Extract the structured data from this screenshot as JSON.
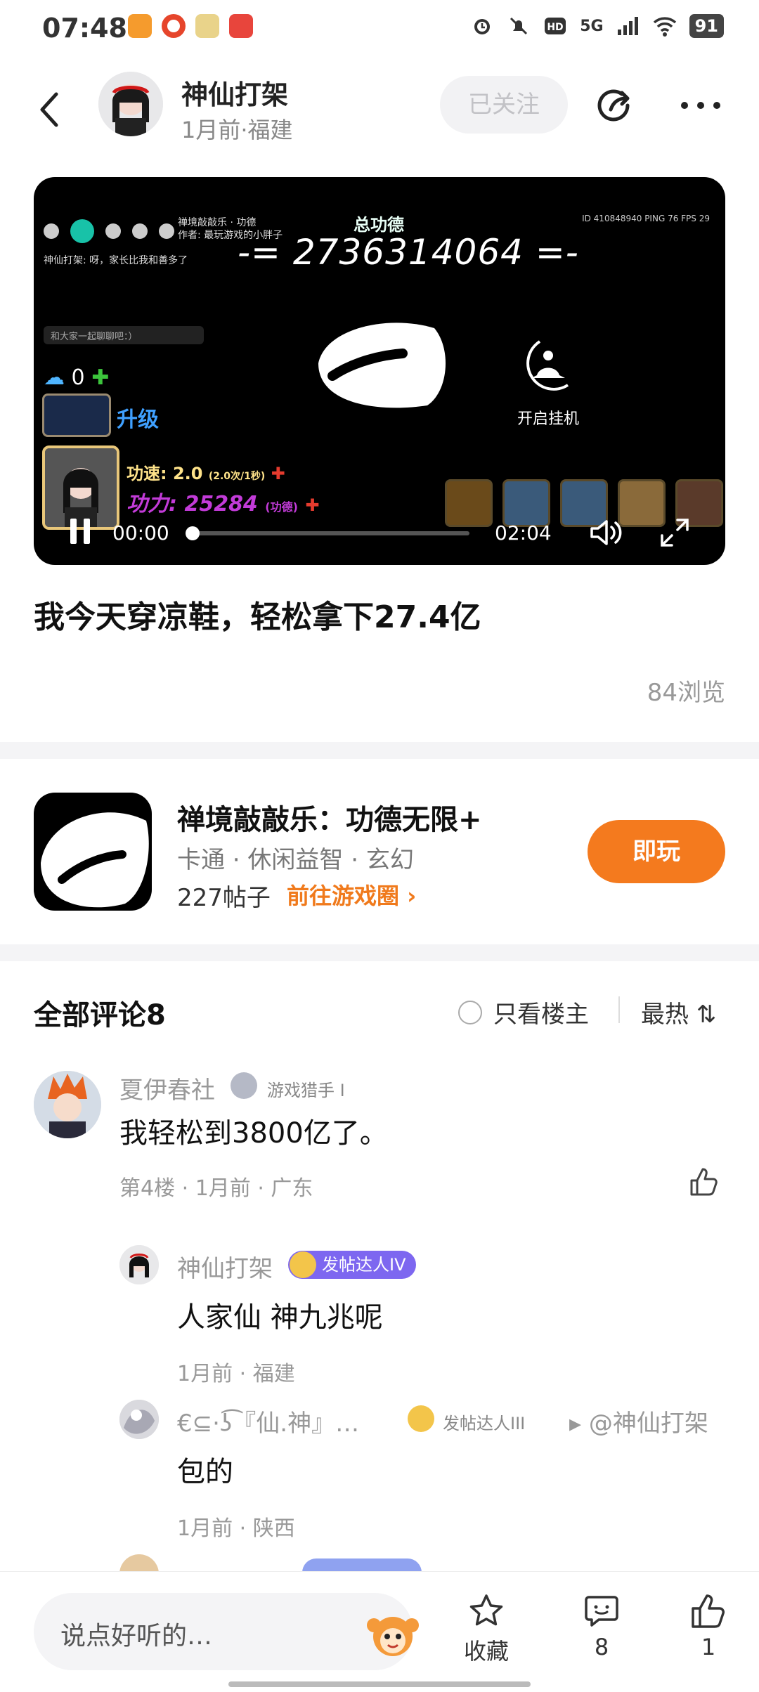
{
  "status_bar": {
    "time": "07:48",
    "network": "5G",
    "battery": "91",
    "icons": [
      "video-app-icon",
      "weibo-icon",
      "game-app-icon",
      "red-app-icon",
      "alarm-icon",
      "mute-icon",
      "hd-icon",
      "signal-icon",
      "wifi-icon",
      "battery-icon"
    ]
  },
  "header": {
    "author_name": "神仙打架",
    "author_meta": "1月前·福建",
    "follow_label": "已关注"
  },
  "video": {
    "top_line": "神仙打架: 呀，家长比我和善多了",
    "player_tag": "禅境敲敲乐 · 功德\n作者: 最玩游戏的小胖子",
    "stats": "ID 410848940   PING 76  FPS 29",
    "title": "总功德",
    "counter": "-= 2736314064 =-",
    "chat_placeholder": "和大家一起聊聊吧：）",
    "cloud_count": "0",
    "upgrade": "升级",
    "speed": "功速: 2.0",
    "speed_unit": "(2.0次/1秒)",
    "power": "功力: 25284",
    "power_unit": "(功德)",
    "hang_label": "开启挂机",
    "time_current": "00:00",
    "time_total": "02:04",
    "progress": 0.0
  },
  "post": {
    "title": "我今天穿凉鞋，轻松拿下27.4亿",
    "views": "84浏览"
  },
  "game": {
    "name": "禅境敲敲乐：功德无限+",
    "tags": "卡通 · 休闲益智 · 玄幻",
    "posts": "227帖子",
    "circle_link": "前往游戏圈 ›",
    "play_label": "即玩"
  },
  "comments": {
    "title": "全部评论8",
    "only_owner": "只看楼主",
    "sort": "最热 ⇅",
    "items": [
      {
        "name": "夏伊春社",
        "badge": "游戏猎手 I",
        "text": "我轻松到3800亿了。",
        "meta": "第4楼 · 1月前 · 广东"
      }
    ],
    "replies": [
      {
        "name": "神仙打架",
        "badge": "发帖达人IV",
        "text": "人家仙   神九兆呢",
        "meta": "1月前 · 福建"
      },
      {
        "name": "€⊆·ʖ͡『仙.神』…",
        "badge": "发帖达人III",
        "reply_to": "▸ @神仙打架",
        "text": "包的",
        "meta": "1月前 · 陕西"
      }
    ]
  },
  "bottom_bar": {
    "input_placeholder": "说点好听的…",
    "collect_label": "收藏",
    "comment_count": "8",
    "like_count": "1"
  },
  "colors": {
    "accent_orange": "#f47a1e",
    "badge_purple": "#7d67f0"
  }
}
